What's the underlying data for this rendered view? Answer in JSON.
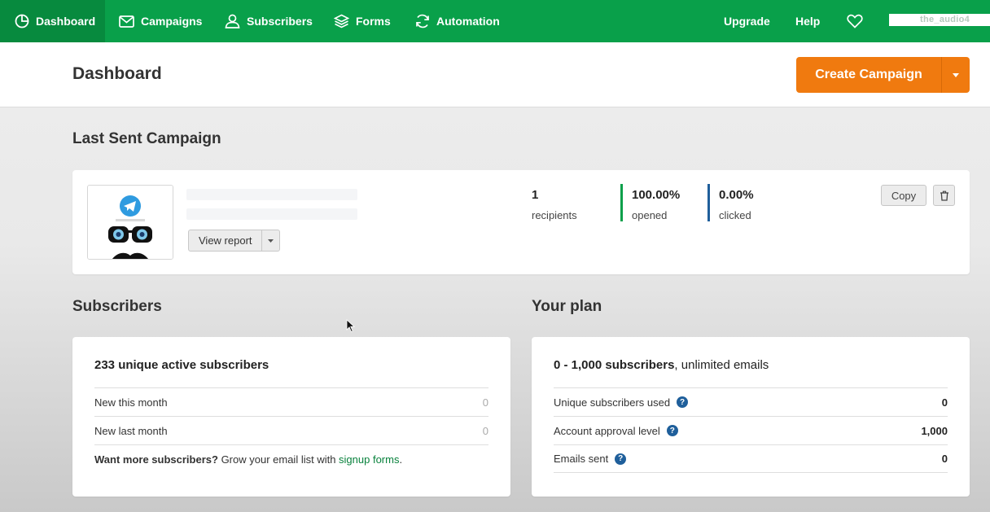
{
  "nav": {
    "items": [
      {
        "label": "Dashboard"
      },
      {
        "label": "Campaigns"
      },
      {
        "label": "Subscribers"
      },
      {
        "label": "Forms"
      },
      {
        "label": "Automation"
      }
    ],
    "upgrade": "Upgrade",
    "help": "Help",
    "user_text": "the_audio4",
    "colors": {
      "bar": "#09a04a",
      "active": "#078a3e"
    }
  },
  "header": {
    "title": "Dashboard",
    "create_label": "Create Campaign",
    "create_color": "#f07a0f"
  },
  "last_campaign": {
    "section_title": "Last Sent Campaign",
    "view_report": "View report",
    "recipients": {
      "value": "1",
      "label": "recipients"
    },
    "opened": {
      "value": "100.00%",
      "label": "opened",
      "color": "#09a04a"
    },
    "clicked": {
      "value": "0.00%",
      "label": "clicked",
      "color": "#1f5f9b"
    },
    "copy_label": "Copy"
  },
  "subscribers": {
    "section_title": "Subscribers",
    "headline": "233 unique active subscribers",
    "rows": [
      {
        "label": "New this month",
        "value": "0"
      },
      {
        "label": "New last month",
        "value": "0"
      }
    ],
    "promo_bold": "Want more subscribers?",
    "promo_text": " Grow your email list with ",
    "promo_link": "signup forms",
    "promo_end": "."
  },
  "plan": {
    "section_title": "Your plan",
    "headline_bold": "0 - 1,000 subscribers",
    "headline_rest": ", unlimited emails",
    "rows": [
      {
        "label": "Unique subscribers used",
        "value": "0"
      },
      {
        "label": "Account approval level",
        "value": "1,000"
      },
      {
        "label": "Emails sent",
        "value": "0"
      }
    ],
    "help_glyph": "?"
  }
}
